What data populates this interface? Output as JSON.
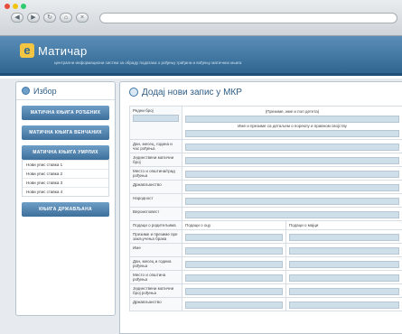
{
  "browser": {
    "traffic_lights": [
      "#e74c3c",
      "#f1c40f",
      "#2ecc71"
    ],
    "nav_icons": [
      "back-icon",
      "forward-icon",
      "reload-icon",
      "home-icon",
      "stop-icon"
    ]
  },
  "site": {
    "logo_letter": "e",
    "title": "Матичар",
    "subtitle": "централни информациони систем за обраду података о рођењу грађана и вођењу матичних књига",
    "colors": {
      "header": "#2f6590",
      "button": "#3c6f9b",
      "input": "#cfdfe9",
      "logo": "#f4c542"
    }
  },
  "sidebar": {
    "heading": "Избор",
    "buttons": [
      "МАТИЧНА КЊИГА РОЂЕНИХ",
      "МАТИЧНА КЊИГА ВЕНЧАНИХ",
      "МАТИЧНА КЊИГА УМРЛИХ"
    ],
    "submenu": [
      "Нови упис ставка 1",
      "Нови упис ставка 2",
      "Нови упис ставка 3",
      "Нови упис ставка 4"
    ],
    "bottom_button": "КЊИГА ДРЖАВЉАНА"
  },
  "main": {
    "title": "Додај нови запис у МКР",
    "form": {
      "row_birth": {
        "label": "Редни број",
        "header": "(Презиме, име и пол детета)",
        "note": "Име и презиме са детаљем о пореклу и правном својству"
      },
      "rows_top": [
        "Дан, месец, година и час рођења",
        "Јединствени матични број",
        "Место и општина/град рођења",
        "Држављанство",
        "Народност",
        "Вероисповест"
      ],
      "parents_label": "Подаци о родитељима",
      "col_father": "Подаци о оцу",
      "col_mother": "Подаци о мајци",
      "rows_parents": [
        "Презиме и презиме пре закључења брака",
        "Име",
        "Дан, месец и година рођења",
        "Место и општина рођења",
        "Јединствени матични број рођења",
        "Држављанство"
      ]
    }
  }
}
